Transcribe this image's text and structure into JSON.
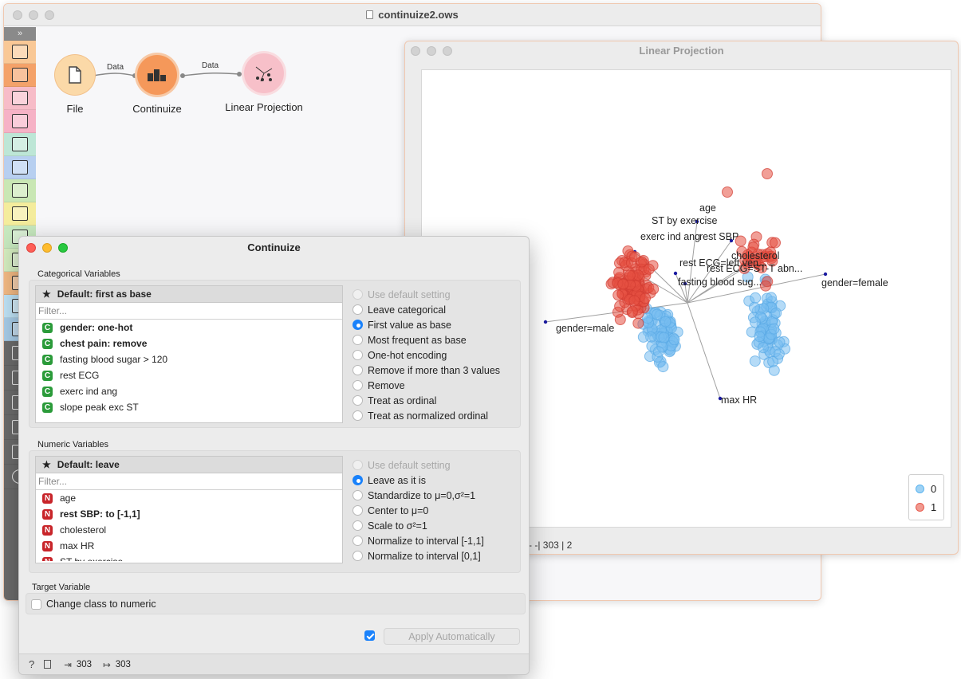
{
  "main_window": {
    "title": "continuize2.ows",
    "nodes": [
      {
        "label": "File"
      },
      {
        "label": "Continuize"
      },
      {
        "label": "Linear Projection"
      }
    ],
    "links": [
      "Data",
      "Data"
    ]
  },
  "projection_window": {
    "title": "Linear Projection",
    "axis_labels": {
      "age": "age",
      "st": "ST by exercise",
      "exerc": "exerc ind ang",
      "sbp": "rest SBP",
      "chol": "cholesterol",
      "ecg_left": "rest ECG=left ven...",
      "ecg_st": "rest ECG=ST-T abn...",
      "fbs": "fasting blood sug...",
      "female": "gender=female",
      "male": "gender=male",
      "maxhr": "max HR"
    },
    "legend": [
      {
        "label": "0",
        "color": "#5ab4f0"
      },
      {
        "label": "1",
        "color": "#e8584b"
      }
    ],
    "status": "-  -| 303 | 2"
  },
  "continuize": {
    "title": "Continuize",
    "categorical": {
      "section_title": "Categorical Variables",
      "default_label": "Default: first as base",
      "filter_placeholder": "Filter...",
      "items": [
        {
          "badge": "C",
          "label": "gender: one-hot"
        },
        {
          "badge": "C",
          "label": "chest pain: remove"
        },
        {
          "badge": "C",
          "label": "fasting blood sugar > 120"
        },
        {
          "badge": "C",
          "label": "rest ECG"
        },
        {
          "badge": "C",
          "label": "exerc ind ang"
        },
        {
          "badge": "C",
          "label": "slope peak exc ST"
        }
      ],
      "options": [
        "Use default setting",
        "Leave categorical",
        "First value as base",
        "Most frequent as base",
        "One-hot encoding",
        "Remove if more than 3 values",
        "Remove",
        "Treat as ordinal",
        "Treat as normalized ordinal"
      ],
      "selected_index": 2
    },
    "numeric": {
      "section_title": "Numeric Variables",
      "default_label": "Default: leave",
      "filter_placeholder": "Filter...",
      "items": [
        {
          "badge": "N",
          "label": "age"
        },
        {
          "badge": "N",
          "label": "rest SBP: to [-1,1]"
        },
        {
          "badge": "N",
          "label": "cholesterol"
        },
        {
          "badge": "N",
          "label": "max HR"
        },
        {
          "badge": "N",
          "label": "ST by exercise"
        }
      ],
      "options": [
        "Use default setting",
        "Leave as it is",
        "Standardize to μ=0,σ²=1",
        "Center to μ=0",
        "Scale to σ²=1",
        "Normalize to interval [-1,1]",
        "Normalize to interval [0,1]"
      ],
      "selected_index": 1
    },
    "target": {
      "section_title": "Target Variable",
      "checkbox_label": "Change class to numeric",
      "checked": false
    },
    "apply_auto_checked": true,
    "apply_label": "Apply Automatically",
    "status": {
      "input_count": "303",
      "output_count": "303"
    }
  }
}
